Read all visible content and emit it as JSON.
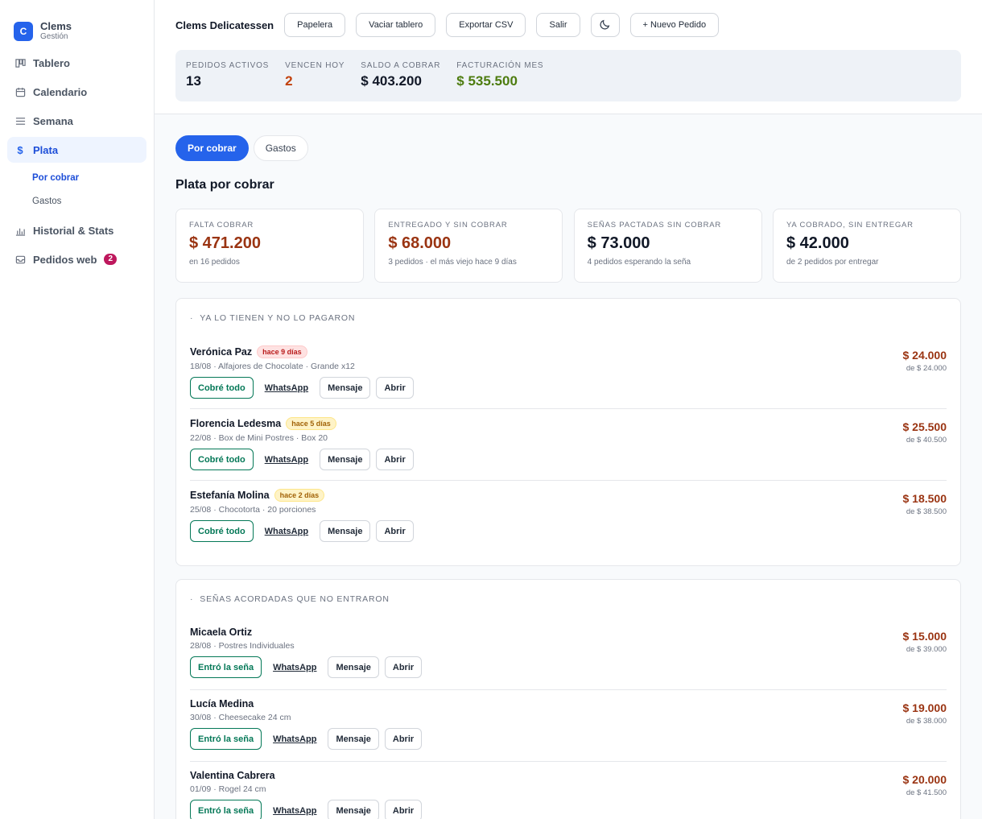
{
  "brand": {
    "initial": "C",
    "name": "Clems",
    "sub": "Gestión"
  },
  "sidebar": {
    "items": [
      {
        "label": "Tablero",
        "icon": "board-icon"
      },
      {
        "label": "Calendario",
        "icon": "calendar-icon"
      },
      {
        "label": "Semana",
        "icon": "list-icon"
      },
      {
        "label": "Plata",
        "icon": "dollar-icon"
      },
      {
        "label": "Historial & Stats",
        "icon": "chart-icon"
      },
      {
        "label": "Pedidos web",
        "icon": "inbox-icon",
        "badge": "2"
      }
    ],
    "subitems": [
      "Por cobrar",
      "Gastos"
    ]
  },
  "header": {
    "title": "Clems Delicatessen",
    "buttons": [
      "Papelera",
      "Vaciar tablero",
      "Exportar CSV",
      "Salir",
      "+ Nuevo Pedido"
    ],
    "stats": [
      {
        "label": "PEDIDOS ACTIVOS",
        "value": "13"
      },
      {
        "label": "VENCEN HOY",
        "value": "2"
      },
      {
        "label": "SALDO A COBRAR",
        "value": "$ 403.200"
      },
      {
        "label": "FACTURACIÓN MES",
        "value": "$ 535.500"
      }
    ]
  },
  "tabs": [
    "Por cobrar",
    "Gastos"
  ],
  "page_title": "Plata por cobrar",
  "kpis": [
    {
      "label": "FALTA COBRAR",
      "value": "$ 471.200",
      "sub": "en 16 pedidos"
    },
    {
      "label": "ENTREGADO Y SIN COBRAR",
      "value": "$ 68.000",
      "sub": "3 pedidos · el más viejo hace 9 días"
    },
    {
      "label": "SEÑAS PACTADAS SIN COBRAR",
      "value": "$ 73.000",
      "sub": "4 pedidos esperando la seña"
    },
    {
      "label": "YA COBRADO, SIN ENTREGAR",
      "value": "$ 42.000",
      "sub": "de 2 pedidos por entregar"
    }
  ],
  "sections": [
    {
      "title": "YA LO TIENEN Y NO LO PAGARON",
      "action_label": "Cobré todo",
      "rows": [
        {
          "name": "Verónica Paz",
          "pill": "hace 9 días",
          "detail": "18/08 · Alfajores de Chocolate · Grande x12",
          "amount": "$ 24.000",
          "of": "de $ 24.000"
        },
        {
          "name": "Florencia Ledesma",
          "pill": "hace 5 días",
          "detail": "22/08 · Box de Mini Postres · Box 20",
          "amount": "$ 25.500",
          "of": "de $ 40.500"
        },
        {
          "name": "Estefanía Molina",
          "pill": "hace 2 días",
          "detail": "25/08 · Chocotorta · 20 porciones",
          "amount": "$ 18.500",
          "of": "de $ 38.500"
        }
      ]
    },
    {
      "title": "SEÑAS ACORDADAS QUE NO ENTRARON",
      "action_label": "Entró la seña",
      "rows": [
        {
          "name": "Micaela Ortiz",
          "detail": "28/08 · Postres Individuales",
          "amount": "$ 15.000",
          "of": "de $ 39.000"
        },
        {
          "name": "Lucía Medina",
          "detail": "30/08 · Cheesecake 24 cm",
          "amount": "$ 19.000",
          "of": "de $ 38.000"
        },
        {
          "name": "Valentina Cabrera",
          "detail": "01/09 · Rogel 24 cm",
          "amount": "$ 20.000",
          "of": "de $ 41.500"
        }
      ]
    }
  ],
  "row_buttons": {
    "whatsapp": "WhatsApp",
    "mensaje": "Mensaje",
    "abrir": "Abrir"
  }
}
